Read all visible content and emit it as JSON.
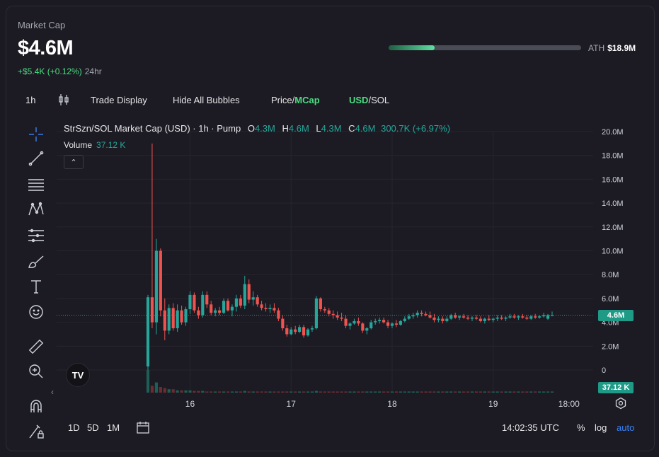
{
  "header": {
    "label": "Market Cap",
    "value": "$4.6M",
    "change": "+$5.4K (+0.12%)",
    "period": "24hr",
    "ath_label": "ATH",
    "ath_value": "$18.9M",
    "ath_progress": 0.24
  },
  "toolbar": {
    "interval": "1h",
    "candle_icon": "candlestick-icon",
    "trade_display": "Trade Display",
    "hide_bubbles": "Hide All Bubbles",
    "price": "Price",
    "slash1": "/",
    "mcap": "MCap",
    "usd": "USD",
    "slash2": "/",
    "sol": "SOL"
  },
  "sidebar": {
    "icons": [
      "crosshair-icon",
      "trendline-icon",
      "fib-icon",
      "pattern-icon",
      "projection-icon",
      "brush-icon",
      "text-icon",
      "emoji-icon",
      "ruler-icon",
      "zoom-in-icon",
      "magnet-icon",
      "lock-draw-icon"
    ],
    "collapse": "‹"
  },
  "legend": {
    "title": "StrSzn/SOL Market Cap (USD) · 1h · Pump",
    "o_label": "O",
    "o": "4.3M",
    "h_label": "H",
    "h": "4.6M",
    "l_label": "L",
    "l": "4.3M",
    "c_label": "C",
    "c": "4.6M",
    "change": "300.7K (+6.97%)",
    "volume_label": "Volume",
    "volume_value": "37.12 K",
    "collapse_btn": "⌃"
  },
  "price_axis": {
    "ticks": [
      "20.0M",
      "18.0M",
      "16.0M",
      "14.0M",
      "12.0M",
      "10.0M",
      "8.0M",
      "6.0M",
      "4.0M",
      "2.0M",
      "0"
    ],
    "current_tag": "4.6M",
    "volume_tag": "37.12 K"
  },
  "time_axis": {
    "ticks": [
      "16",
      "17",
      "18",
      "19",
      "18:00"
    ]
  },
  "bottom": {
    "ranges": [
      "1D",
      "5D",
      "1M"
    ],
    "time": "14:02:35 UTC",
    "percent": "%",
    "log": "log",
    "auto": "auto"
  },
  "chart_data": {
    "type": "candlestick",
    "ylim": [
      0,
      20000000
    ],
    "current": 4600000,
    "x": [
      "15 14:00",
      "15 15:00",
      "15 16:00",
      "15 17:00",
      "15 18:00",
      "15 19:00",
      "15 20:00",
      "15 21:00",
      "15 22:00",
      "15 23:00",
      "16 00:00",
      "16 01:00",
      "16 02:00",
      "16 03:00",
      "16 04:00",
      "16 05:00",
      "16 06:00",
      "16 07:00",
      "16 08:00",
      "16 09:00",
      "16 10:00",
      "16 11:00",
      "16 12:00",
      "16 13:00",
      "16 14:00",
      "16 15:00",
      "16 16:00",
      "16 17:00",
      "16 18:00",
      "16 19:00",
      "16 20:00",
      "16 21:00",
      "16 22:00",
      "16 23:00",
      "17 00:00",
      "17 01:00",
      "17 02:00",
      "17 03:00",
      "17 04:00",
      "17 05:00",
      "17 06:00",
      "17 07:00",
      "17 08:00",
      "17 09:00",
      "17 10:00",
      "17 11:00",
      "17 12:00",
      "17 13:00",
      "17 14:00",
      "17 15:00",
      "17 16:00",
      "17 17:00",
      "17 18:00",
      "17 19:00",
      "17 20:00",
      "17 21:00",
      "17 22:00",
      "17 23:00",
      "18 00:00",
      "18 01:00",
      "18 02:00",
      "18 03:00",
      "18 04:00",
      "18 05:00",
      "18 06:00",
      "18 07:00",
      "18 08:00",
      "18 09:00",
      "18 10:00",
      "18 11:00",
      "18 12:00",
      "18 13:00",
      "18 14:00",
      "18 15:00",
      "18 16:00",
      "18 17:00",
      "18 18:00",
      "18 19:00",
      "18 20:00",
      "18 21:00",
      "18 22:00",
      "18 23:00",
      "19 00:00",
      "19 01:00",
      "19 02:00",
      "19 03:00",
      "19 04:00",
      "19 05:00",
      "19 06:00",
      "19 07:00",
      "19 08:00",
      "19 09:00",
      "19 10:00",
      "19 11:00",
      "19 12:00",
      "19 13:00",
      "19 14:00"
    ],
    "ohlc": [
      [
        0.3,
        6.3,
        0,
        6.1
      ],
      [
        6.1,
        19.0,
        3.5,
        4.0
      ],
      [
        4.0,
        11.0,
        3.0,
        10.0
      ],
      [
        10.0,
        10.2,
        4.5,
        5.0
      ],
      [
        5.0,
        6.0,
        2.5,
        3.3
      ],
      [
        3.3,
        5.5,
        3.0,
        5.2
      ],
      [
        5.2,
        5.6,
        3.3,
        3.5
      ],
      [
        3.5,
        5.5,
        3.2,
        5.0
      ],
      [
        5.0,
        5.4,
        3.8,
        4.0
      ],
      [
        4.0,
        5.3,
        3.7,
        5.1
      ],
      [
        5.1,
        6.6,
        4.7,
        6.3
      ],
      [
        6.3,
        6.5,
        4.8,
        5.0
      ],
      [
        5.0,
        5.3,
        4.3,
        4.6
      ],
      [
        4.6,
        6.6,
        4.4,
        6.3
      ],
      [
        6.3,
        6.6,
        5.2,
        5.5
      ],
      [
        5.5,
        5.8,
        4.6,
        4.8
      ],
      [
        4.8,
        5.2,
        4.5,
        5.0
      ],
      [
        5.0,
        5.3,
        4.6,
        4.8
      ],
      [
        4.8,
        6.0,
        4.7,
        5.8
      ],
      [
        5.8,
        6.0,
        4.9,
        5.0
      ],
      [
        5.0,
        5.5,
        4.5,
        5.3
      ],
      [
        5.3,
        6.3,
        4.9,
        6.0
      ],
      [
        6.0,
        6.3,
        5.2,
        5.4
      ],
      [
        5.4,
        7.9,
        5.1,
        7.2
      ],
      [
        7.2,
        7.6,
        5.6,
        5.9
      ],
      [
        5.9,
        6.6,
        5.4,
        6.1
      ],
      [
        6.1,
        6.3,
        5.3,
        5.5
      ],
      [
        5.5,
        5.8,
        5.0,
        5.2
      ],
      [
        5.2,
        5.6,
        4.9,
        5.1
      ],
      [
        5.1,
        5.5,
        4.8,
        5.2
      ],
      [
        5.2,
        5.6,
        4.8,
        5.0
      ],
      [
        5.0,
        5.2,
        4.1,
        4.3
      ],
      [
        4.3,
        4.6,
        3.3,
        3.5
      ],
      [
        3.5,
        3.8,
        2.8,
        3.0
      ],
      [
        3.0,
        3.6,
        2.9,
        3.4
      ],
      [
        3.4,
        3.7,
        3.0,
        3.2
      ],
      [
        3.2,
        3.8,
        3.1,
        3.6
      ],
      [
        3.6,
        3.8,
        2.7,
        2.9
      ],
      [
        2.9,
        3.5,
        2.8,
        3.4
      ],
      [
        3.4,
        3.7,
        3.2,
        3.5
      ],
      [
        3.5,
        6.2,
        3.4,
        6.0
      ],
      [
        6.0,
        6.1,
        4.9,
        5.1
      ],
      [
        5.1,
        5.3,
        4.8,
        5.0
      ],
      [
        5.0,
        5.2,
        4.5,
        4.7
      ],
      [
        4.7,
        5.0,
        4.3,
        4.6
      ],
      [
        4.6,
        4.9,
        4.2,
        4.4
      ],
      [
        4.4,
        4.8,
        4.1,
        4.3
      ],
      [
        4.3,
        4.6,
        3.5,
        3.7
      ],
      [
        3.7,
        4.0,
        3.4,
        3.9
      ],
      [
        3.9,
        4.3,
        3.8,
        4.1
      ],
      [
        4.1,
        4.4,
        3.7,
        3.9
      ],
      [
        3.9,
        4.0,
        3.1,
        3.3
      ],
      [
        3.3,
        3.6,
        3.0,
        3.5
      ],
      [
        3.5,
        4.2,
        3.4,
        4.0
      ],
      [
        4.0,
        4.3,
        3.8,
        4.1
      ],
      [
        4.1,
        4.4,
        3.9,
        4.2
      ],
      [
        4.2,
        4.4,
        3.9,
        4.0
      ],
      [
        4.0,
        4.2,
        3.5,
        3.7
      ],
      [
        3.7,
        4.0,
        3.5,
        3.9
      ],
      [
        3.9,
        4.2,
        3.6,
        3.8
      ],
      [
        3.8,
        4.2,
        3.7,
        4.1
      ],
      [
        4.1,
        4.5,
        4.0,
        4.3
      ],
      [
        4.3,
        4.7,
        4.2,
        4.5
      ],
      [
        4.5,
        4.8,
        4.3,
        4.6
      ],
      [
        4.6,
        5.0,
        4.4,
        4.8
      ],
      [
        4.8,
        5.0,
        4.5,
        4.7
      ],
      [
        4.7,
        4.9,
        4.5,
        4.6
      ],
      [
        4.6,
        4.9,
        4.3,
        4.4
      ],
      [
        4.4,
        4.7,
        4.0,
        4.2
      ],
      [
        4.2,
        4.5,
        4.0,
        4.3
      ],
      [
        4.3,
        4.5,
        3.9,
        4.1
      ],
      [
        4.1,
        4.5,
        4.0,
        4.3
      ],
      [
        4.3,
        4.7,
        4.2,
        4.6
      ],
      [
        4.6,
        4.8,
        4.3,
        4.4
      ],
      [
        4.4,
        4.6,
        4.2,
        4.5
      ],
      [
        4.5,
        4.7,
        4.3,
        4.4
      ],
      [
        4.4,
        4.6,
        4.2,
        4.3
      ],
      [
        4.3,
        4.5,
        4.1,
        4.4
      ],
      [
        4.4,
        4.6,
        4.2,
        4.3
      ],
      [
        4.3,
        4.5,
        4.0,
        4.1
      ],
      [
        4.1,
        4.4,
        3.9,
        4.3
      ],
      [
        4.3,
        4.6,
        4.1,
        4.2
      ],
      [
        4.2,
        4.4,
        4.0,
        4.3
      ],
      [
        4.3,
        4.6,
        4.1,
        4.4
      ],
      [
        4.4,
        4.6,
        4.2,
        4.3
      ],
      [
        4.3,
        4.5,
        4.1,
        4.4
      ],
      [
        4.4,
        4.7,
        4.3,
        4.5
      ],
      [
        4.5,
        4.7,
        4.3,
        4.4
      ],
      [
        4.4,
        4.6,
        4.2,
        4.5
      ],
      [
        4.5,
        4.7,
        4.3,
        4.4
      ],
      [
        4.4,
        4.6,
        4.2,
        4.3
      ],
      [
        4.3,
        4.6,
        4.2,
        4.5
      ],
      [
        4.5,
        4.7,
        4.3,
        4.4
      ],
      [
        4.4,
        4.6,
        4.3,
        4.5
      ],
      [
        4.5,
        4.8,
        4.4,
        4.6
      ],
      [
        4.3,
        4.7,
        4.2,
        4.6
      ],
      [
        4.6,
        4.9,
        4.5,
        4.6
      ]
    ],
    "volume": [
      20,
      6,
      9,
      5,
      4,
      3,
      3,
      2,
      2,
      2,
      2,
      1.5,
      1.5,
      1.5,
      1,
      1,
      1,
      1,
      1,
      1,
      1,
      1,
      1,
      1.5,
      1,
      1,
      1,
      1,
      1,
      1,
      1,
      1,
      1,
      1,
      1,
      1,
      1,
      1,
      1,
      1,
      1.5,
      1,
      1,
      1,
      1,
      1,
      1,
      1,
      1,
      1,
      1,
      1,
      1,
      1,
      1,
      1,
      1,
      1,
      1,
      1,
      1,
      1,
      1,
      1,
      1,
      1,
      1,
      1,
      1,
      1,
      1,
      1,
      1,
      1,
      1,
      1,
      1,
      1,
      1,
      1,
      1,
      1,
      1,
      1,
      1,
      1,
      1,
      1,
      1,
      1,
      1,
      1,
      1,
      1,
      1,
      1,
      1
    ]
  }
}
